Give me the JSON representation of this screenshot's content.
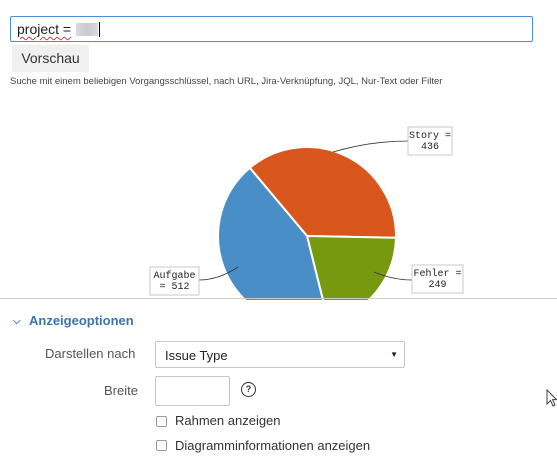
{
  "query": {
    "text": "project =",
    "masked_value_icon": "redacted-block"
  },
  "preview_button": {
    "label": "Vorschau"
  },
  "help_text": "Suche mit einem beliebigen Vorgangsschlüssel, nach URL, Jira-Verknüpfung, JQL, Nur-Text oder Filter",
  "chart_data": {
    "type": "pie",
    "slices": [
      {
        "label": "Story = 436",
        "value": 436,
        "color": "#d9561c"
      },
      {
        "label": "Fehler = 249",
        "value": 249,
        "color": "#76990f"
      },
      {
        "label": "Aufgabe = 512",
        "value": 512,
        "color": "#4a8ec8"
      }
    ],
    "label_lines": [
      [
        "Story =",
        "436"
      ],
      [
        "Fehler =",
        "249"
      ],
      [
        "Aufgabe",
        "= 512"
      ]
    ]
  },
  "options": {
    "header": "Anzeigeoptionen",
    "header_icon": "double-chevron-down-icon",
    "display_by_label": "Darstellen nach",
    "display_by_value": "Issue Type",
    "width_label": "Breite",
    "width_value": "",
    "help_icon": "?",
    "show_border_label": "Rahmen anzeigen",
    "show_border_checked": false,
    "show_info_label": "Diagramminformationen anzeigen",
    "show_info_checked": false
  }
}
